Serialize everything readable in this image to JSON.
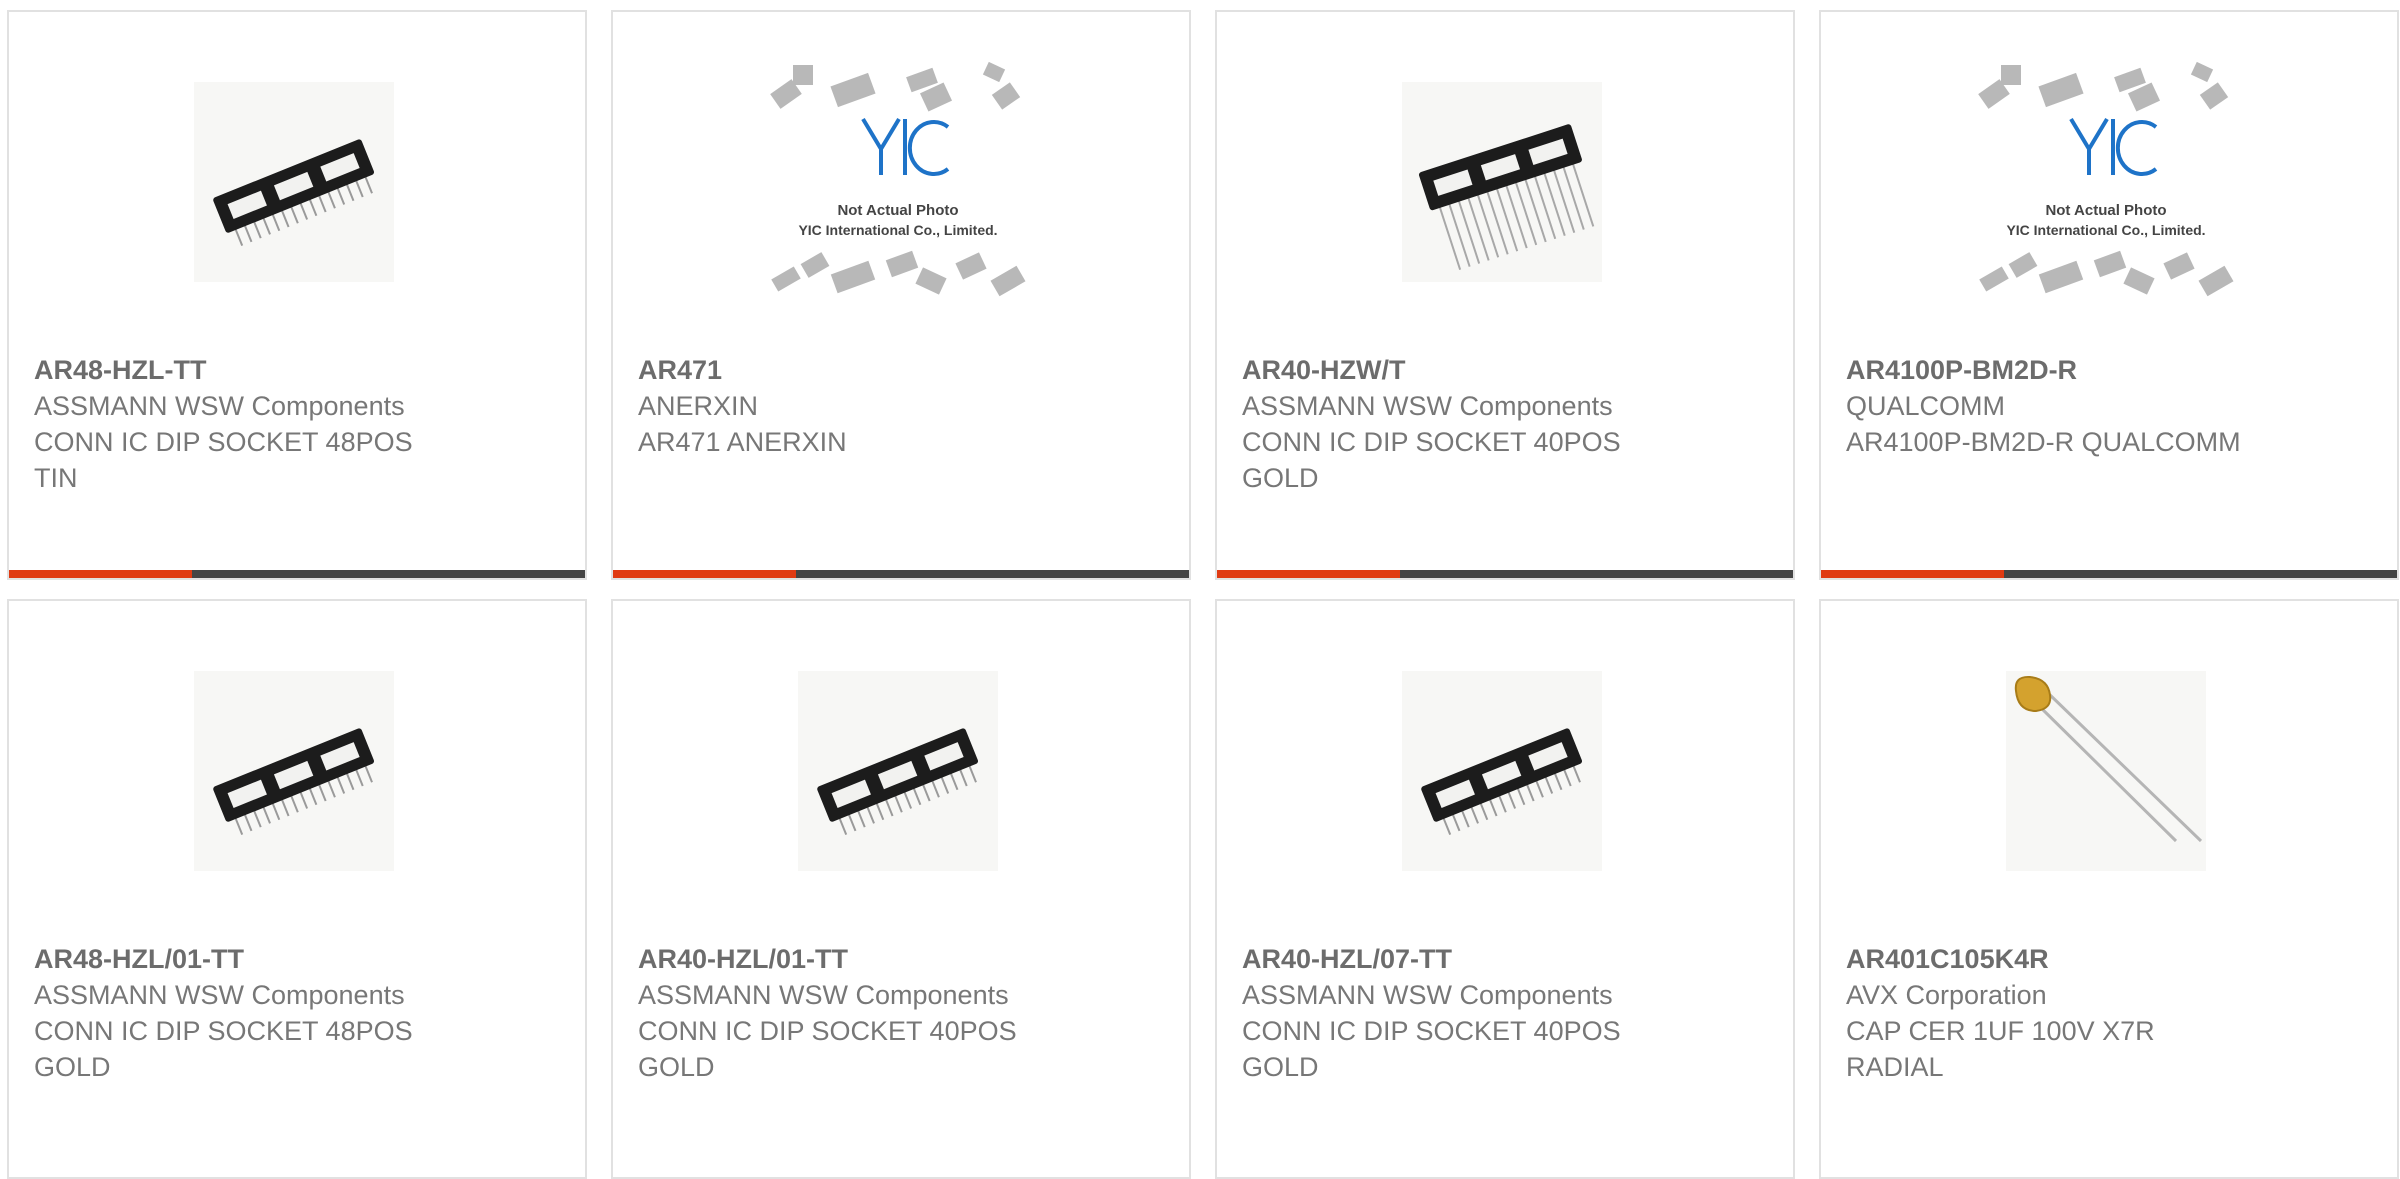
{
  "products": [
    {
      "part": "AR48-HZL-TT",
      "manufacturer": "ASSMANN WSW Components",
      "description": "CONN IC DIP SOCKET 48POS\nTIN",
      "image": "dip-socket-icon"
    },
    {
      "part": "AR471",
      "manufacturer": "ANERXIN",
      "description": "AR471 ANERXIN",
      "image": "yic-placeholder-logo",
      "placeholder_line1": "Not Actual Photo",
      "placeholder_line2": "YIC International Co., Limited."
    },
    {
      "part": "AR40-HZW/T",
      "manufacturer": "ASSMANN WSW Components",
      "description": "CONN IC DIP SOCKET 40POS\nGOLD",
      "image": "dip-socket-long-pins-icon"
    },
    {
      "part": "AR4100P-BM2D-R",
      "manufacturer": "QUALCOMM",
      "description": "AR4100P-BM2D-R QUALCOMM",
      "image": "yic-placeholder-logo",
      "placeholder_line1": "Not Actual Photo",
      "placeholder_line2": "YIC International Co., Limited."
    },
    {
      "part": "AR48-HZL/01-TT",
      "manufacturer": "ASSMANN WSW Components",
      "description": "CONN IC DIP SOCKET 48POS\nGOLD",
      "image": "dip-socket-icon"
    },
    {
      "part": "AR40-HZL/01-TT",
      "manufacturer": "ASSMANN WSW Components",
      "description": "CONN IC DIP SOCKET 40POS\nGOLD",
      "image": "dip-socket-icon"
    },
    {
      "part": "AR40-HZL/07-TT",
      "manufacturer": "ASSMANN WSW Components",
      "description": "CONN IC DIP SOCKET 40POS\nGOLD",
      "image": "dip-socket-icon"
    },
    {
      "part": "AR401C105K4R",
      "manufacturer": "AVX Corporation",
      "description": "CAP CER 1UF 100V X7R\nRADIAL",
      "image": "ceramic-capacitor-icon"
    }
  ],
  "colors": {
    "accent": "#e03a12",
    "bar": "#444444",
    "border": "#e1e1e1",
    "text": "#777777"
  }
}
